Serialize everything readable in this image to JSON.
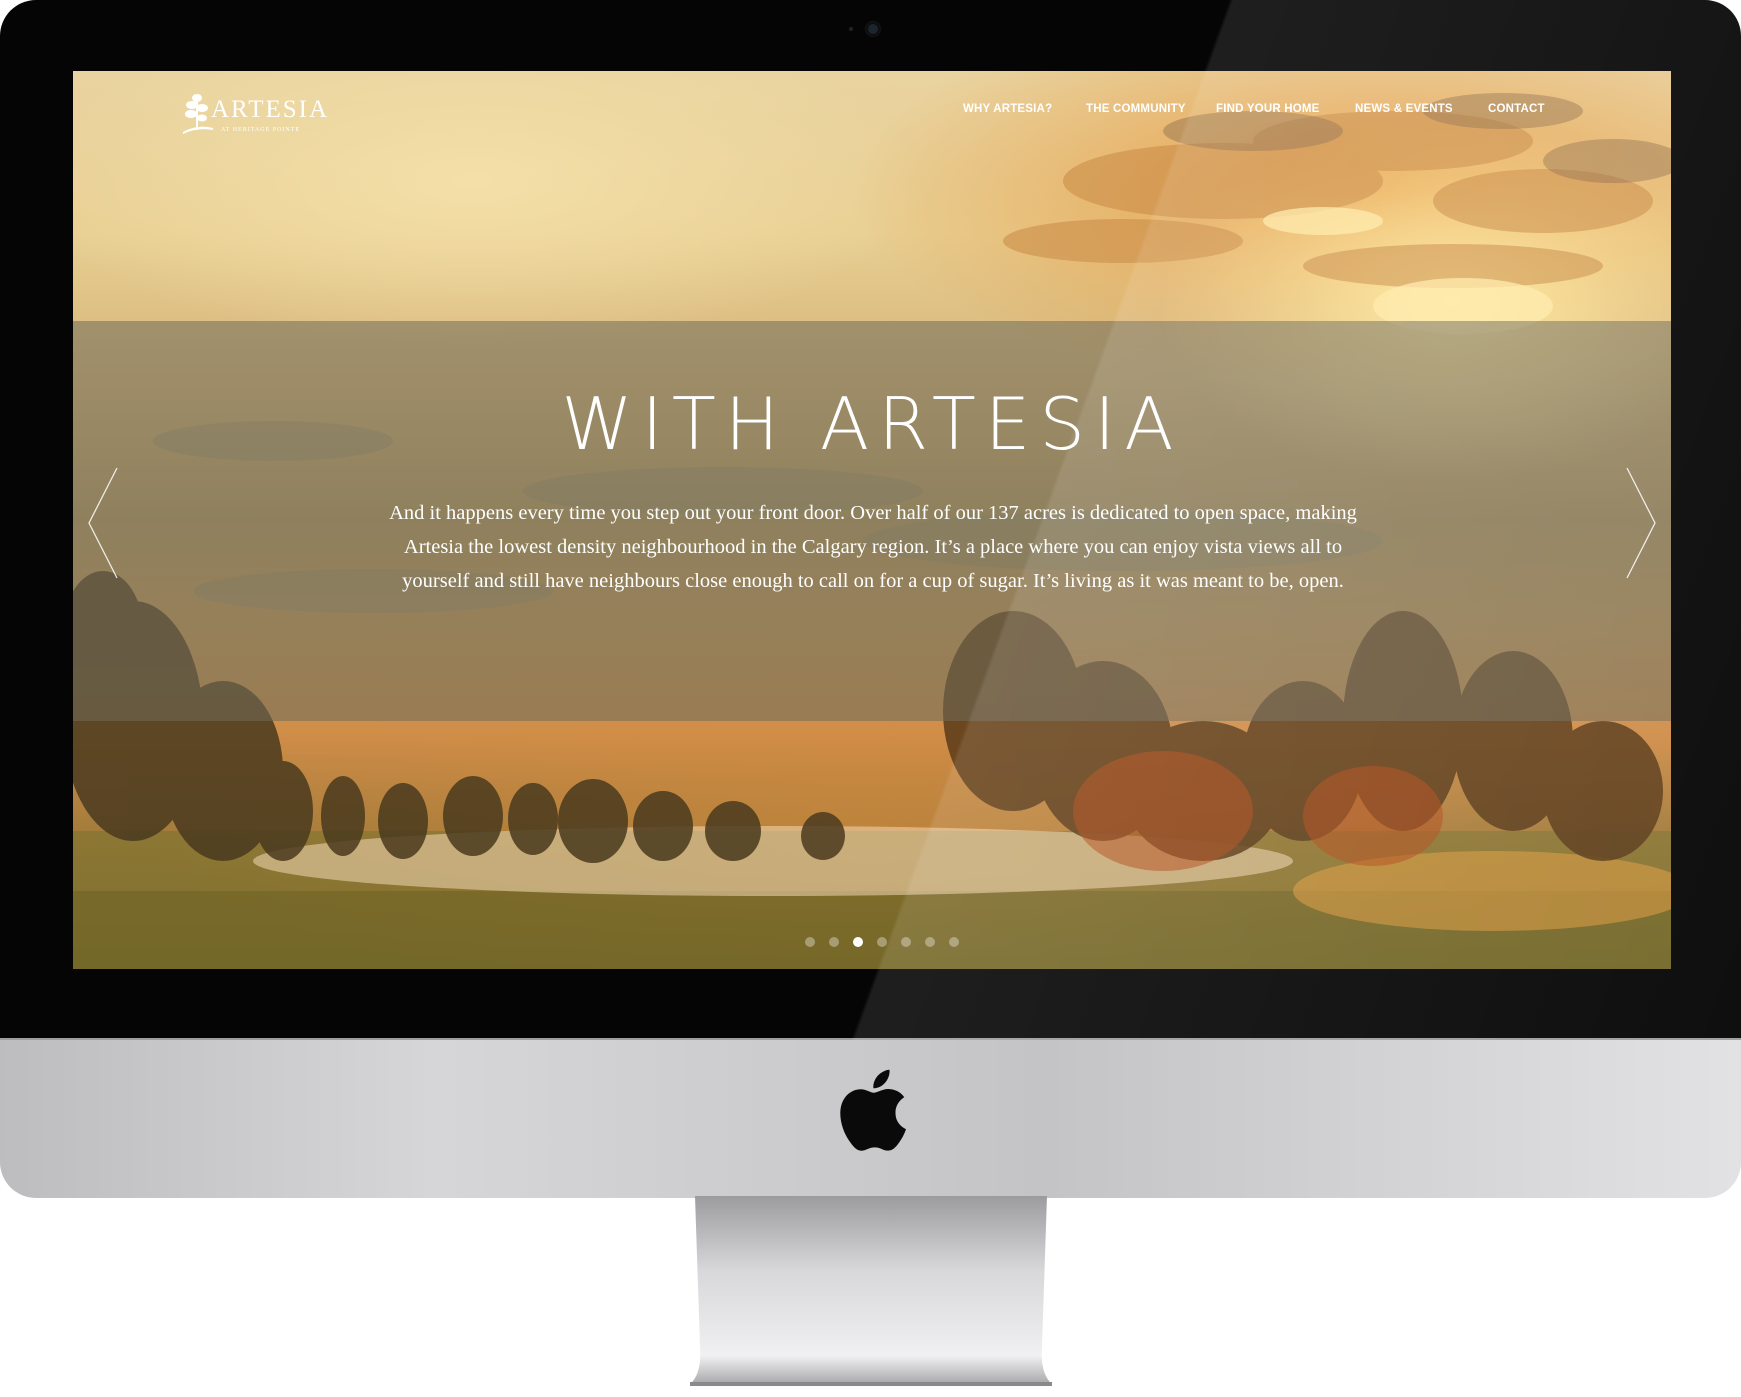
{
  "site": {
    "logo": {
      "name": "ARTESIA",
      "tagline": "AT HERITAGE POINTE"
    },
    "nav": [
      {
        "label": "WHY ARTESIA?"
      },
      {
        "label": "THE COMMUNITY"
      },
      {
        "label": "FIND YOUR HOME"
      },
      {
        "label": "NEWS & EVENTS"
      },
      {
        "label": "CONTACT"
      }
    ]
  },
  "hero": {
    "headline": "WITH ARTESIA",
    "body_line1": "And it happens every time you step out your front door. Over half of our 137 acres is dedicated to open space, making",
    "body_line2": "Artesia the lowest density neighbourhood in the Calgary region. It’s a place where you can enjoy vista views all to",
    "body_line3": "yourself and still have neighbours close enough to call on for a cup of sugar. It’s living as it was meant to be, open.",
    "slides_total": 7,
    "active_slide": 3,
    "prev_icon": "chevron-left-icon",
    "next_icon": "chevron-right-icon"
  },
  "device": {
    "logo_icon": "apple-logo-icon"
  },
  "colors": {
    "band": "#706c5a",
    "text": "#ffffff",
    "bezel": "#050505"
  }
}
